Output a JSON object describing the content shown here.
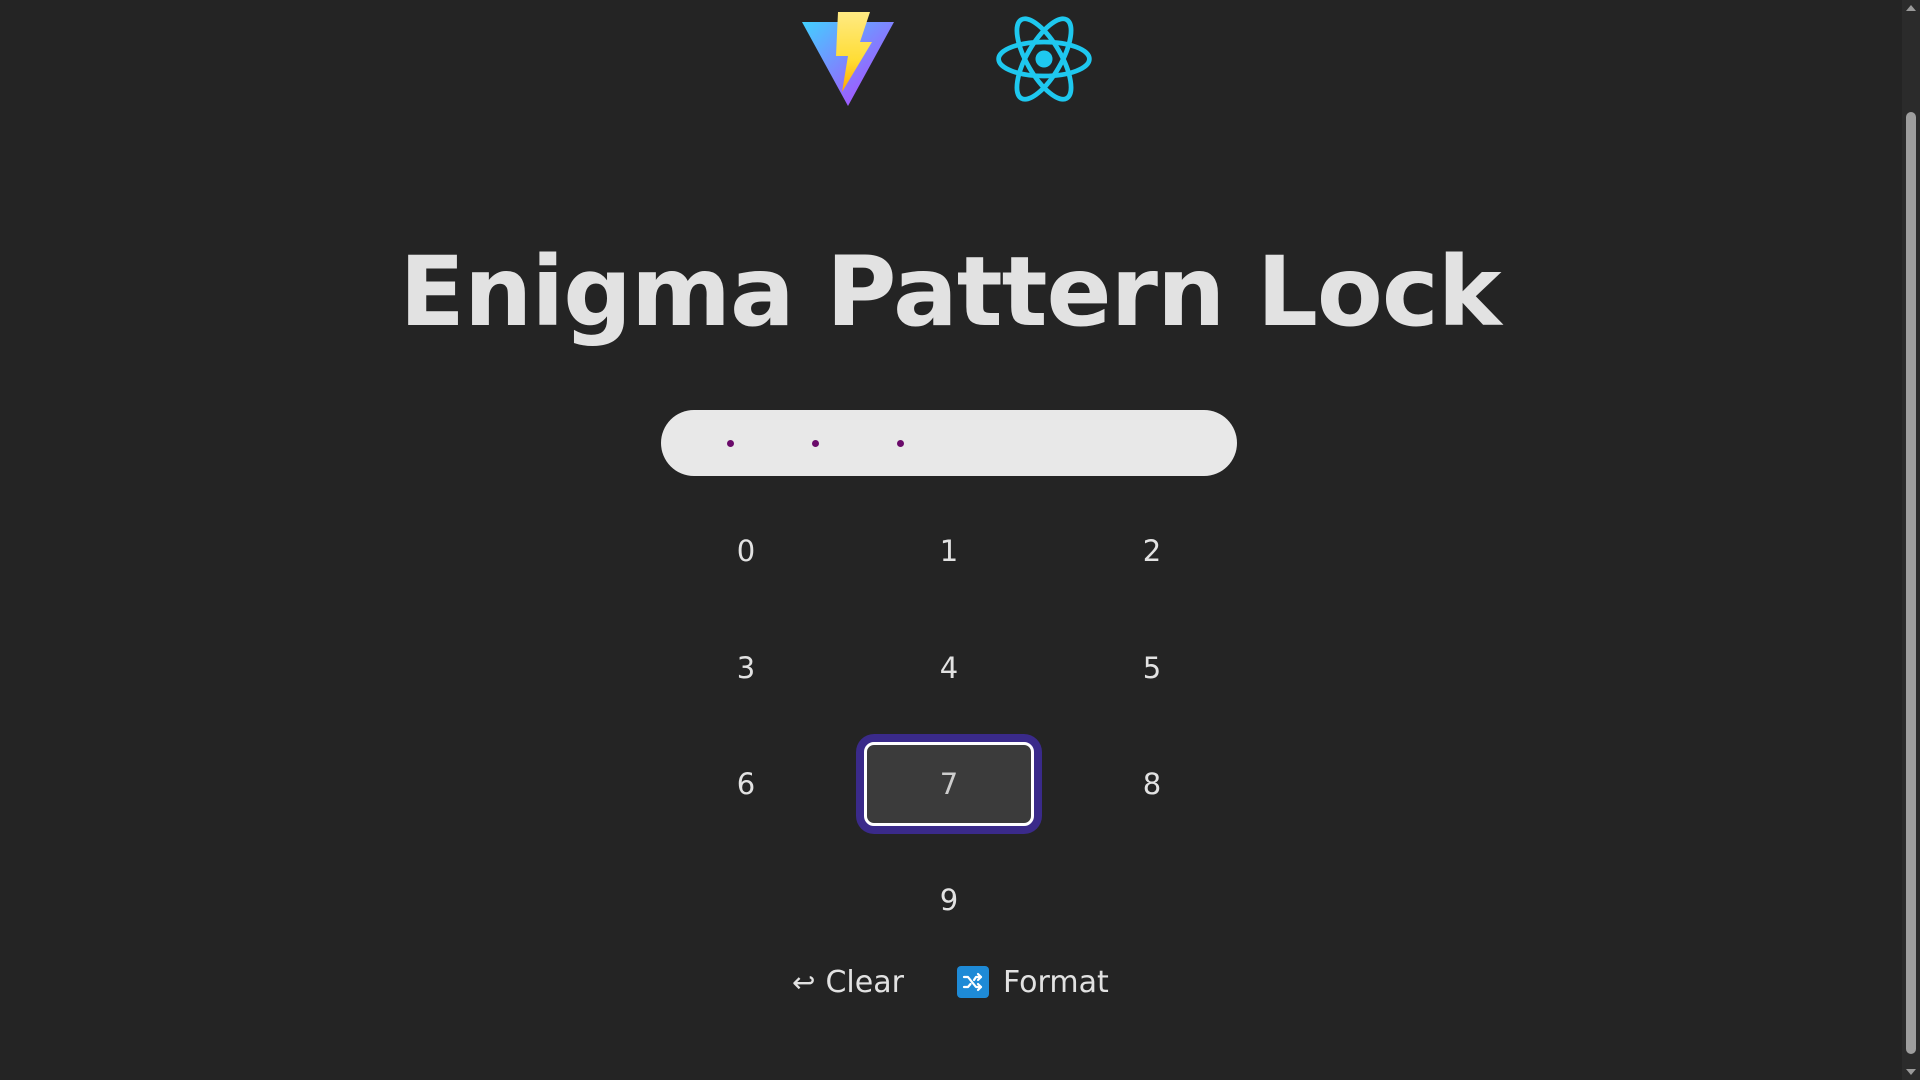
{
  "logos": {
    "vite": "vite-logo",
    "react": "react-logo"
  },
  "title": "Enigma Pattern Lock",
  "pin": {
    "entered_count": 3
  },
  "keypad": {
    "keys": [
      "0",
      "1",
      "2",
      "3",
      "4",
      "5",
      "6",
      "7",
      "8",
      "9"
    ],
    "focused_key": "7"
  },
  "actions": {
    "clear_icon": "↩",
    "clear_label": "Clear",
    "format_icon": "shuffle-icon",
    "format_label": "Format"
  },
  "colors": {
    "background": "#242424",
    "pin_display": "#e8e8e8",
    "pin_dot": "#6a0a6a",
    "focus_ring": "#3a2a8a",
    "shuffle_icon_bg": "#1e8ad6"
  }
}
